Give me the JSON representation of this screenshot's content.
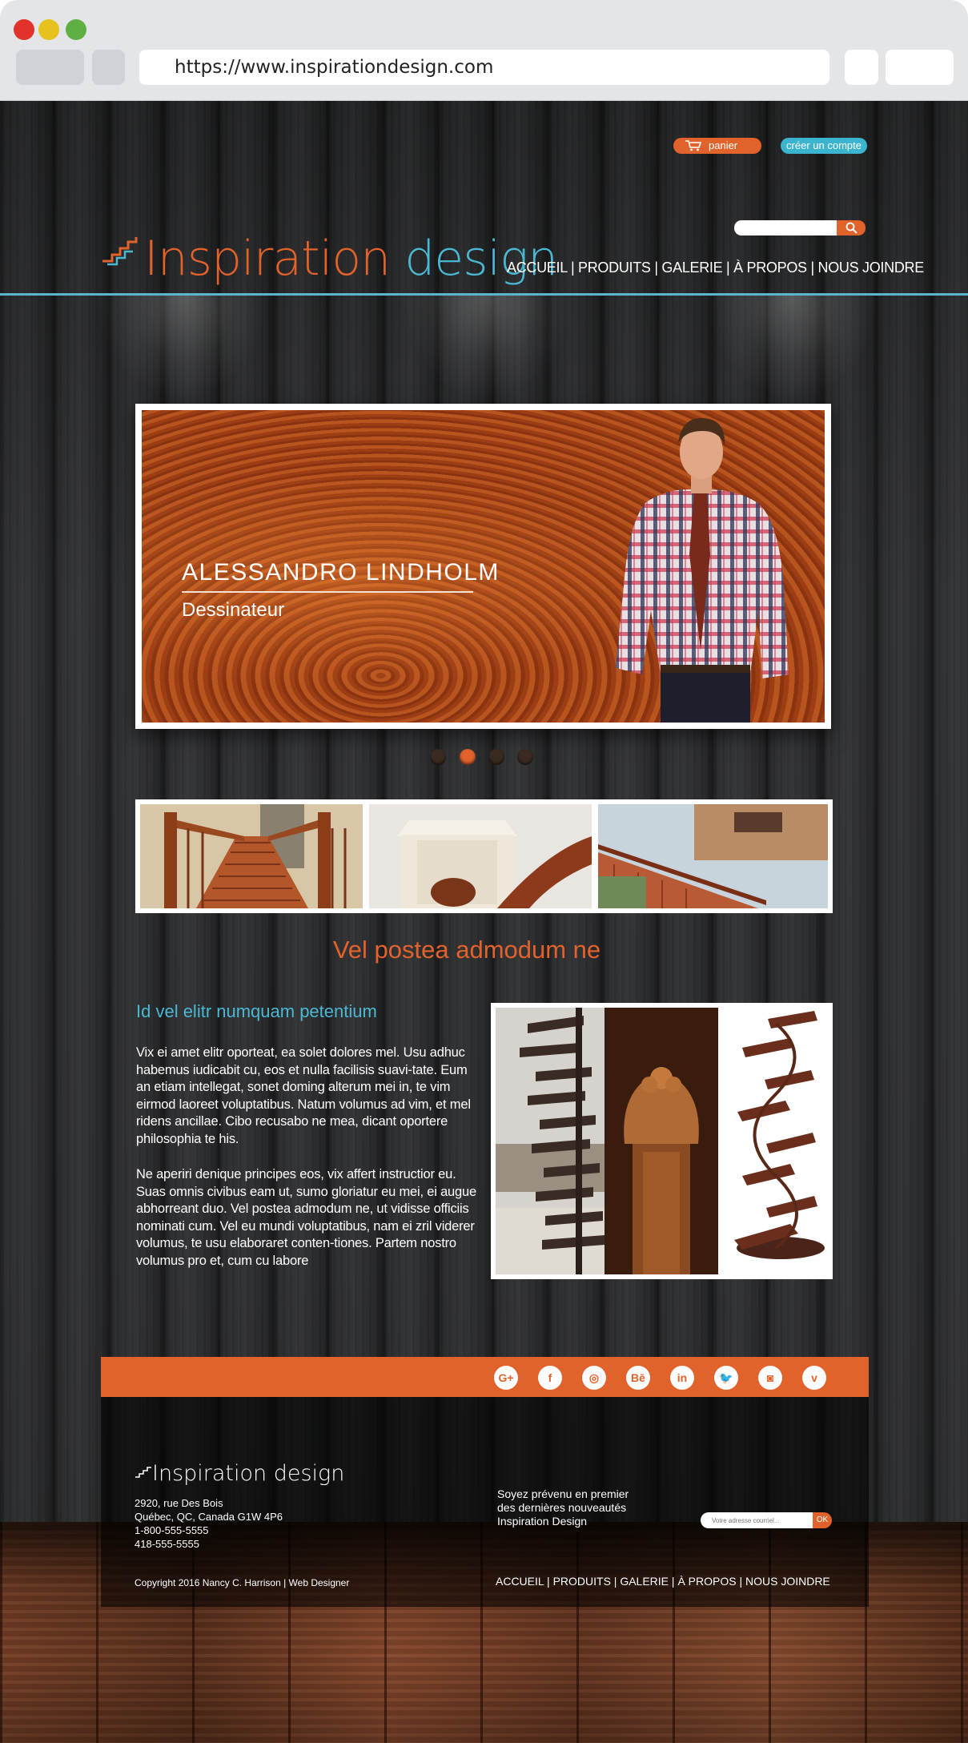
{
  "browser": {
    "url": "https://www.inspirationdesign.com"
  },
  "header": {
    "cart_label": "panier",
    "account_label": "créer un compte",
    "search": {
      "placeholder": ""
    },
    "logo": {
      "word1": "Inspiration",
      "word2": "design"
    },
    "nav": "ACCUEIL | PRODUITS | GALERIE | À PROPOS | NOUS JOINDRE"
  },
  "hero": {
    "name": "ALESSANDRO LINDHOLM",
    "role": "Dessinateur",
    "slides": 4,
    "active_slide": 2
  },
  "content": {
    "headline": "Vel postea admodum ne",
    "subheading": "Id vel elitr numquam petentium",
    "paragraph1": "Vix ei amet elitr oporteat, ea solet dolores mel. Usu adhuc habemus iudicabit cu, eos et nulla facilisis suavi-tate. Eum an etiam intellegat, sonet doming alterum mei in, te vim eirmod laoreet voluptatibus. Natum volumus ad vim, et mel ridens ancillae. Cibo recusabo ne mea, dicant oportere philosophia te his.",
    "paragraph2": "Ne aperiri denique principes eos, vix affert instructior eu. Suas omnis civibus eam ut, sumo gloriatur eu mei, ei augue abhorreant duo. Vel postea admodum ne, ut vidisse officiis nominati cum. Vel eu mundi voluptatibus, nam ei zril viderer volumus, te usu elaboraret conten-tiones. Partem nostro volumus pro et, cum cu labore"
  },
  "social": [
    {
      "icon": "google-plus-icon",
      "glyph": "G+"
    },
    {
      "icon": "facebook-icon",
      "glyph": "f"
    },
    {
      "icon": "dribbble-icon",
      "glyph": "◎"
    },
    {
      "icon": "behance-icon",
      "glyph": "Bē"
    },
    {
      "icon": "linkedin-icon",
      "glyph": "in"
    },
    {
      "icon": "twitter-icon",
      "glyph": "🐦"
    },
    {
      "icon": "instagram-icon",
      "glyph": "◙"
    },
    {
      "icon": "vimeo-icon",
      "glyph": "v"
    }
  ],
  "footer": {
    "logo_text": "Inspiration design",
    "address_line1": "2920, rue Des Bois",
    "address_line2": "Québec, QC, Canada G1W 4P6",
    "phone1": "1-800-555-5555",
    "phone2": "418-555-5555",
    "copyright": "Copyright 2016 Nancy C. Harrison | Web Designer",
    "newsletter_line1": "Soyez prévenu en premier",
    "newsletter_line2": "des dernières nouveautés",
    "newsletter_line3": "Inspiration Design",
    "email_placeholder": "Votre adresse courriel...",
    "ok_label": "OK",
    "nav": "ACCUEIL | PRODUITS | GALERIE | À PROPOS | NOUS JOINDRE"
  },
  "colors": {
    "accent_orange": "#e2622c",
    "accent_blue": "#4bb8d3"
  }
}
